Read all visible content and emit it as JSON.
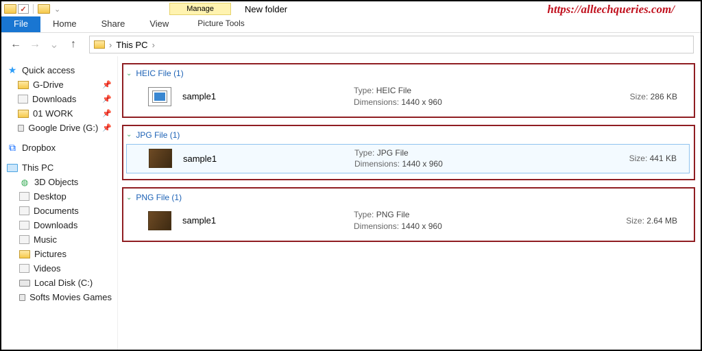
{
  "titlebar": {
    "contextual_tab": "Manage",
    "contextual_group": "Picture Tools",
    "window_title": "New folder",
    "watermark": "https://alltechqueries.com/"
  },
  "ribbon": {
    "file": "File",
    "tabs": [
      "Home",
      "Share",
      "View"
    ]
  },
  "address": {
    "location": "This PC"
  },
  "sidebar": {
    "quick_access": "Quick access",
    "qa_items": [
      {
        "label": "G-Drive"
      },
      {
        "label": "Downloads"
      },
      {
        "label": "01 WORK"
      },
      {
        "label": "Google Drive (G:)"
      }
    ],
    "dropbox": "Dropbox",
    "this_pc": "This PC",
    "pc_items": [
      {
        "label": "3D Objects"
      },
      {
        "label": "Desktop"
      },
      {
        "label": "Documents"
      },
      {
        "label": "Downloads"
      },
      {
        "label": "Music"
      },
      {
        "label": "Pictures"
      },
      {
        "label": "Videos"
      },
      {
        "label": "Local Disk (C:)"
      },
      {
        "label": "Softs Movies Games"
      }
    ]
  },
  "groups": [
    {
      "header": "HEIC File (1)",
      "thumb": "heic",
      "selected": false,
      "name": "sample1",
      "type_label": "Type:",
      "type_value": "HEIC File",
      "dim_label": "Dimensions:",
      "dim_value": "1440 x 960",
      "size_label": "Size:",
      "size_value": "286 KB"
    },
    {
      "header": "JPG File (1)",
      "thumb": "img",
      "selected": true,
      "name": "sample1",
      "type_label": "Type:",
      "type_value": "JPG File",
      "dim_label": "Dimensions:",
      "dim_value": "1440 x 960",
      "size_label": "Size:",
      "size_value": "441 KB"
    },
    {
      "header": "PNG File (1)",
      "thumb": "img",
      "selected": false,
      "name": "sample1",
      "type_label": "Type:",
      "type_value": "PNG File",
      "dim_label": "Dimensions:",
      "dim_value": "1440 x 960",
      "size_label": "Size:",
      "size_value": "2.64 MB"
    }
  ]
}
